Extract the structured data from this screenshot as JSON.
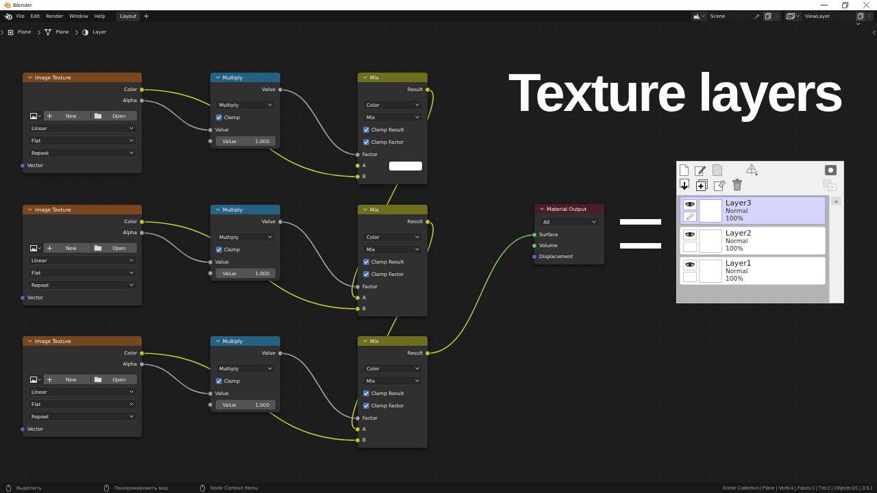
{
  "window": {
    "title": "Blender"
  },
  "menu": [
    "File",
    "Edit",
    "Render",
    "Window",
    "Help"
  ],
  "workspace_tabs": [
    {
      "label": "Layout",
      "selected": true
    }
  ],
  "scene": {
    "name": "Scene",
    "remove_disabled": true
  },
  "view_layer": {
    "name": "ViewLayer",
    "remove_disabled": true
  },
  "breadcrumbs": [
    {
      "kind": "object",
      "label": "Plane"
    },
    {
      "kind": "mesh",
      "label": "Plane"
    },
    {
      "kind": "material",
      "label": "Layer"
    }
  ],
  "nodes": [
    {
      "kind": "image_texture",
      "title": "Image Texture",
      "outputs": [
        {
          "label": "Color",
          "kind": "color"
        },
        {
          "label": "Alpha",
          "kind": "float"
        }
      ],
      "image_buttons": [
        "New",
        "Open"
      ],
      "dropdowns": [
        "Linear",
        "Flat",
        "Repeat"
      ],
      "inputs": [
        {
          "label": "Vector",
          "kind": "vector"
        }
      ]
    },
    {
      "kind": "math",
      "title": "Multiply",
      "outputs": [
        {
          "label": "Value",
          "kind": "float"
        }
      ],
      "dropdowns": [
        "Multiply"
      ],
      "checkboxes": [
        {
          "label": "Clamp",
          "checked": true
        }
      ],
      "inputs": [
        {
          "label": "Value",
          "kind": "float"
        },
        {
          "label": "Value",
          "value": "1.000",
          "kind": "float"
        }
      ]
    },
    {
      "kind": "mix",
      "title": "Mix",
      "outputs": [
        {
          "label": "Result",
          "kind": "color"
        }
      ],
      "dropdowns": [
        "Color",
        "Mix"
      ],
      "checkboxes": [
        {
          "label": "Clamp Result",
          "checked": true
        },
        {
          "label": "Clamp Factor",
          "checked": true
        }
      ],
      "inputs": [
        {
          "label": "Factor",
          "kind": "float"
        },
        {
          "label": "A",
          "kind": "color",
          "color": "#ffffff"
        },
        {
          "label": "B",
          "kind": "color"
        }
      ]
    },
    {
      "kind": "image_texture",
      "title": "Image Texture",
      "outputs": [
        {
          "label": "Color",
          "kind": "color"
        },
        {
          "label": "Alpha",
          "kind": "float"
        }
      ],
      "image_buttons": [
        "New",
        "Open"
      ],
      "dropdowns": [
        "Linear",
        "Flat",
        "Repeat"
      ],
      "inputs": [
        {
          "label": "Vector",
          "kind": "vector"
        }
      ]
    },
    {
      "kind": "math",
      "title": "Multiply",
      "outputs": [
        {
          "label": "Value",
          "kind": "float"
        }
      ],
      "dropdowns": [
        "Multiply"
      ],
      "checkboxes": [
        {
          "label": "Clamp",
          "checked": true
        }
      ],
      "inputs": [
        {
          "label": "Value",
          "kind": "float"
        },
        {
          "label": "Value",
          "value": "1.000",
          "kind": "float"
        }
      ]
    },
    {
      "kind": "mix",
      "title": "Mix",
      "outputs": [
        {
          "label": "Result",
          "kind": "color"
        }
      ],
      "dropdowns": [
        "Color",
        "Mix"
      ],
      "checkboxes": [
        {
          "label": "Clamp Result",
          "checked": true
        },
        {
          "label": "Clamp Factor",
          "checked": true
        }
      ],
      "inputs": [
        {
          "label": "Factor",
          "kind": "float"
        },
        {
          "label": "A",
          "kind": "color"
        },
        {
          "label": "B",
          "kind": "color"
        }
      ]
    },
    {
      "kind": "output",
      "title": "Material Output",
      "dropdowns": [
        "All"
      ],
      "inputs": [
        {
          "label": "Surface",
          "kind": "shader"
        },
        {
          "label": "Volume",
          "kind": "shader"
        },
        {
          "label": "Displacement",
          "kind": "vector"
        }
      ]
    },
    {
      "kind": "image_texture",
      "title": "Image Texture",
      "outputs": [
        {
          "label": "Color",
          "kind": "color"
        },
        {
          "label": "Alpha",
          "kind": "float"
        }
      ],
      "image_buttons": [
        "New",
        "Open"
      ],
      "dropdowns": [
        "Linear",
        "Flat",
        "Repeat"
      ],
      "inputs": [
        {
          "label": "Vector",
          "kind": "vector"
        }
      ]
    },
    {
      "kind": "math",
      "title": "Multiply",
      "outputs": [
        {
          "label": "Value",
          "kind": "float"
        }
      ],
      "dropdowns": [
        "Multiply"
      ],
      "checkboxes": [
        {
          "label": "Clamp",
          "checked": true
        }
      ],
      "inputs": [
        {
          "label": "Value",
          "kind": "float"
        },
        {
          "label": "Value",
          "value": "1.000",
          "kind": "float"
        }
      ]
    },
    {
      "kind": "mix",
      "title": "Mix",
      "outputs": [
        {
          "label": "Result",
          "kind": "color"
        }
      ],
      "dropdowns": [
        "Color",
        "Mix"
      ],
      "checkboxes": [
        {
          "label": "Clamp Result",
          "checked": true
        },
        {
          "label": "Clamp Factor",
          "checked": true
        }
      ],
      "inputs": [
        {
          "label": "Factor",
          "kind": "float"
        },
        {
          "label": "A",
          "kind": "color"
        },
        {
          "label": "B",
          "kind": "color"
        }
      ]
    }
  ],
  "overlay": {
    "title": "Texture layers"
  },
  "layers_panel": {
    "layers": [
      {
        "name": "Layer3",
        "blend_mode": "Normal",
        "opacity": "100%",
        "visible": true,
        "selected": true
      },
      {
        "name": "Layer2",
        "blend_mode": "Normal",
        "opacity": "100%",
        "visible": true,
        "selected": false
      },
      {
        "name": "Layer1",
        "blend_mode": "Normal",
        "opacity": "100%",
        "visible": true,
        "selected": false
      }
    ]
  },
  "status_bar": {
    "hints": [
      "Выделить",
      "Панорамировать вид",
      "Node Context Menu"
    ],
    "stats": "Scene Collection | Plane | Verts:4 | Faces:1 | Tris:2 | Objects:0/1 | 3.5.1"
  }
}
